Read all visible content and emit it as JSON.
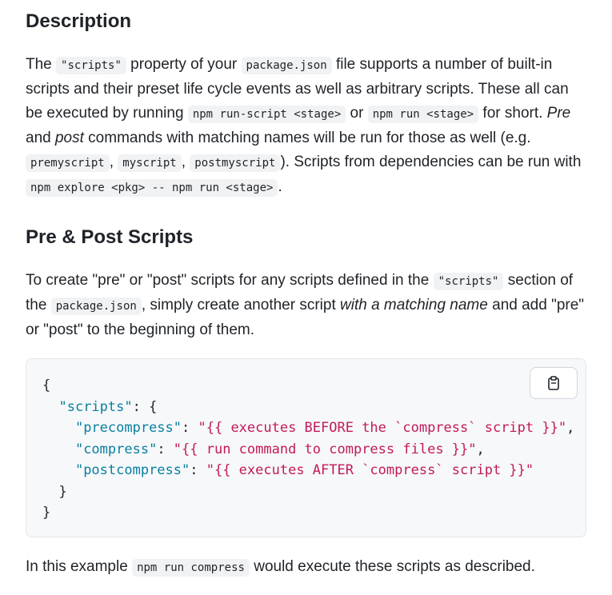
{
  "headings": {
    "description": "Description",
    "pre_post": "Pre & Post Scripts"
  },
  "description": {
    "t1": "The ",
    "c1": "\"scripts\"",
    "t2": " property of your ",
    "c2": "package.json",
    "t3": " file supports a number of built-in scripts and their preset life cycle events as well as arbitrary scripts. These all can be executed by running ",
    "c3": "npm run-script <stage>",
    "t4": " or ",
    "c4": "npm run <stage>",
    "t5": " for short. ",
    "e1": "Pre",
    "t6": " and ",
    "e2": "post",
    "t7": " commands with matching names will be run for those as well (e.g. ",
    "c5": "premyscript",
    "t8": ", ",
    "c6": "myscript",
    "t9": ", ",
    "c7": "postmyscript",
    "t10": "). Scripts from dependencies can be run with ",
    "c8": "npm explore <pkg> -- npm run <stage>",
    "t11": "."
  },
  "pre_post_text": {
    "t1": "To create \"pre\" or \"post\" scripts for any scripts defined in the ",
    "c1": "\"scripts\"",
    "t2": " section of the ",
    "c2": "package.json",
    "t3": ", simply create another script ",
    "e1": "with a matching name",
    "t4": " and add \"pre\" or \"post\" to the beginning of them."
  },
  "code_block": {
    "open_brace": "{",
    "scripts_key": "\"scripts\"",
    "scripts_colon": ": {",
    "entries": [
      {
        "key": "\"precompress\"",
        "sep": ": ",
        "value": "\"{{ executes BEFORE the `compress` script }}\"",
        "trail": ","
      },
      {
        "key": "\"compress\"",
        "sep": ": ",
        "value": "\"{{ run command to compress files }}\"",
        "trail": ","
      },
      {
        "key": "\"postcompress\"",
        "sep": ": ",
        "value": "\"{{ executes AFTER `compress` script }}\"",
        "trail": ""
      }
    ],
    "inner_close": "}",
    "outer_close": "}",
    "copy_icon": "clipboard-icon"
  },
  "example": {
    "t1": "In this example ",
    "c1": "npm run compress",
    "t2": " would execute these scripts as described."
  },
  "colors": {
    "key": "#0a7ea0",
    "string": "#c4195a",
    "code_bg": "#f6f8fa",
    "inline_code_bg": "#f0f2f4"
  }
}
